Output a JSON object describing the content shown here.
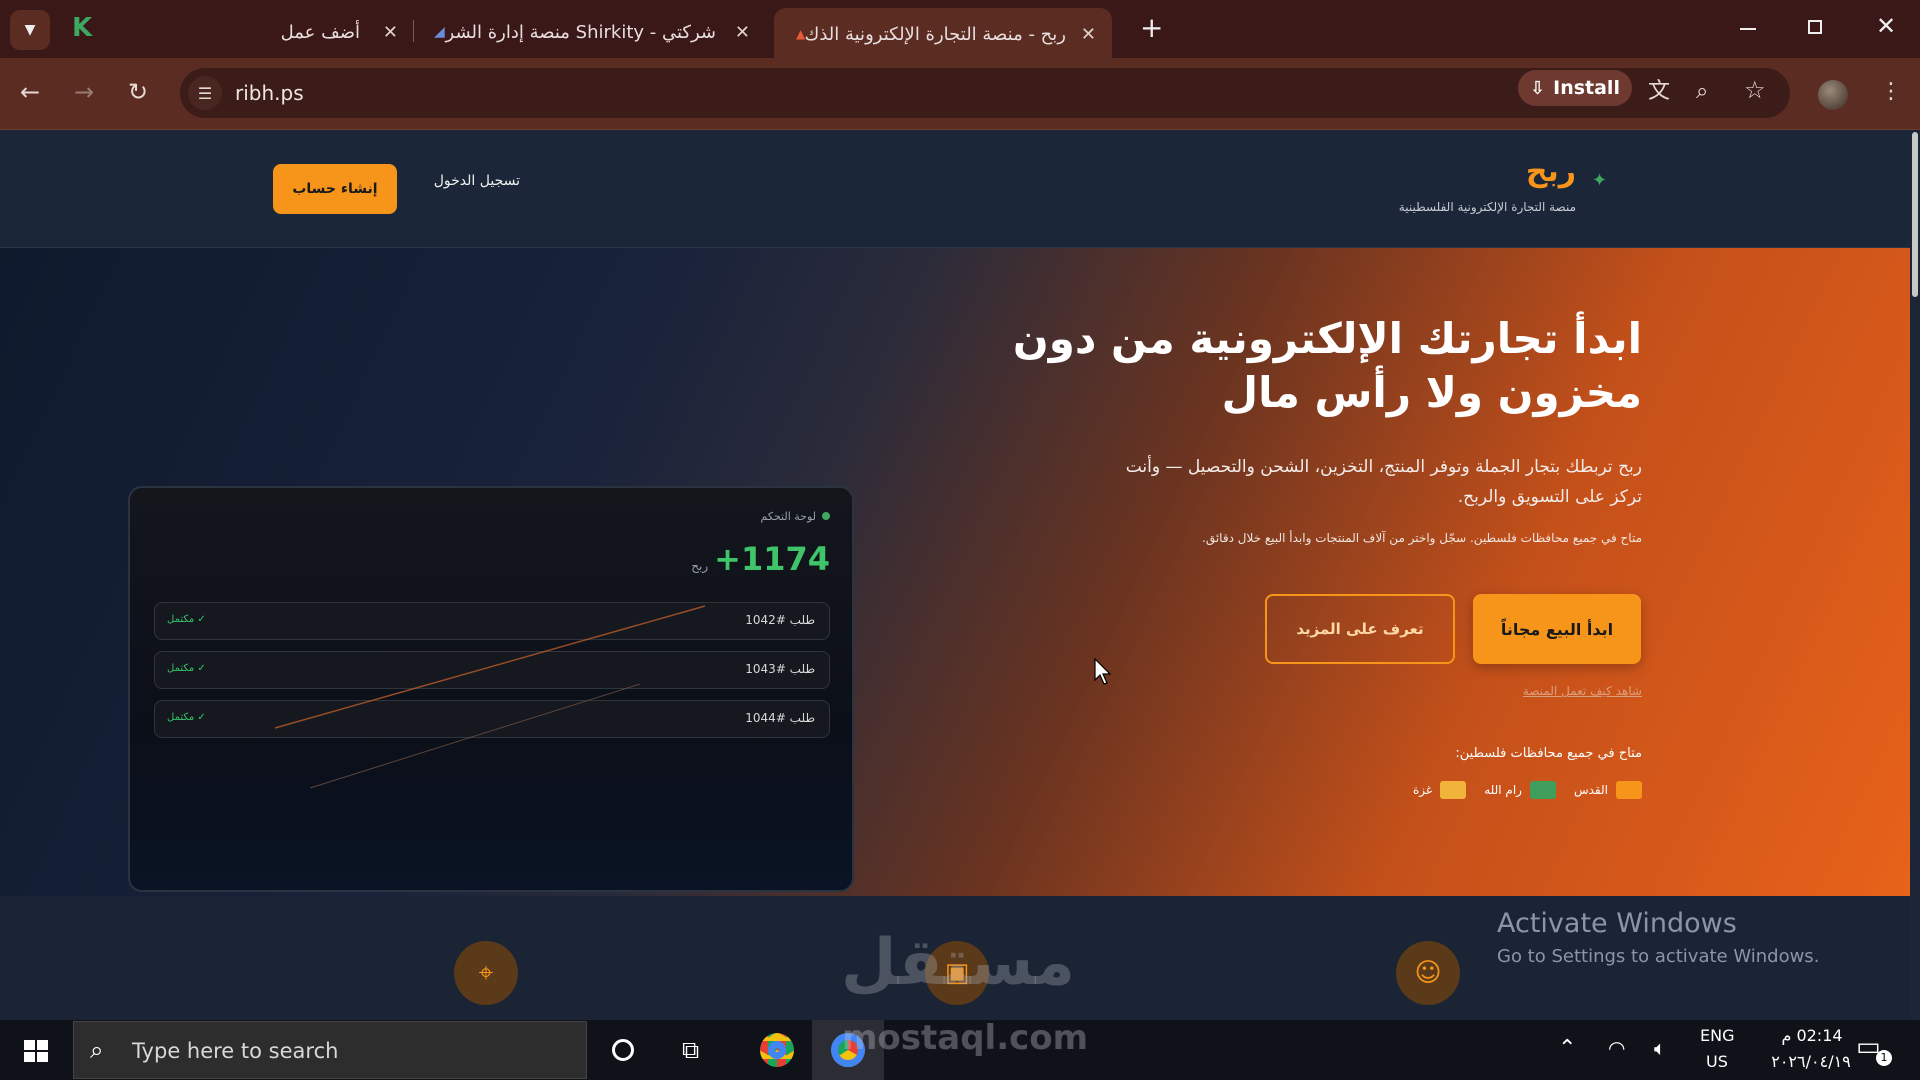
{
  "browser": {
    "tabs": [
      {
        "title": "أضف عمل"
      },
      {
        "title": "شركتي - Shirkity منصة إدارة الشر"
      },
      {
        "title": "ربح - منصة التجارة الإلكترونية الذك"
      }
    ],
    "new_tab": "+",
    "url": "ribh.ps",
    "install_label": "Install"
  },
  "site": {
    "brand_name": "ربح",
    "brand_tagline": "منصة التجارة الإلكترونية الفلسطينية",
    "login_label": "تسجيل الدخول",
    "signup_label": "إنشاء حساب"
  },
  "hero": {
    "title_line1": "ابدأ تجارتك الإلكترونية من دون",
    "title_line2": "مخزون ولا رأس مال",
    "desc_line1": "ربح تربطك بتجار الجملة وتوفر المنتج، التخزين، الشحن والتحصيل — وأنت",
    "desc_line2": "تركز على التسويق والربح.",
    "availability": "متاح في جميع محافظات فلسطين. سجّل واختر من آلاف المنتجات وابدأ البيع خلال دقائق.",
    "primary_cta": "ابدأ البيع مجاناً",
    "secondary_cta": "تعرف على المزيد",
    "how_link": "شاهد كيف تعمل المنصة",
    "regions_title": "متاح في جميع محافظات فلسطين:",
    "regions": [
      {
        "name": "القدس",
        "color": "#f7951b"
      },
      {
        "name": "رام الله",
        "color": "#3f9e5c"
      },
      {
        "name": "غزة",
        "color": "#f2b33a"
      }
    ]
  },
  "dashboard": {
    "label": "لوحة التحكم",
    "value": "+1174",
    "unit": "ربح",
    "orders": [
      {
        "id": "طلب #1042",
        "status": "✓ مكتمل"
      },
      {
        "id": "طلب #1043",
        "status": "✓ مكتمل"
      },
      {
        "id": "طلب #1044",
        "status": "✓ مكتمل"
      }
    ]
  },
  "watermark": {
    "activate_title": "Activate Windows",
    "activate_sub": "Go to Settings to activate Windows.",
    "logo_text": "مستقل",
    "logo_url": "mostaql.com"
  },
  "taskbar": {
    "search_placeholder": "Type here to search",
    "lang_top": "ENG",
    "lang_bottom": "US",
    "time": "02:14 م",
    "date": "٢٠٢٦/٠٤/١٩",
    "notif_count": "1"
  }
}
